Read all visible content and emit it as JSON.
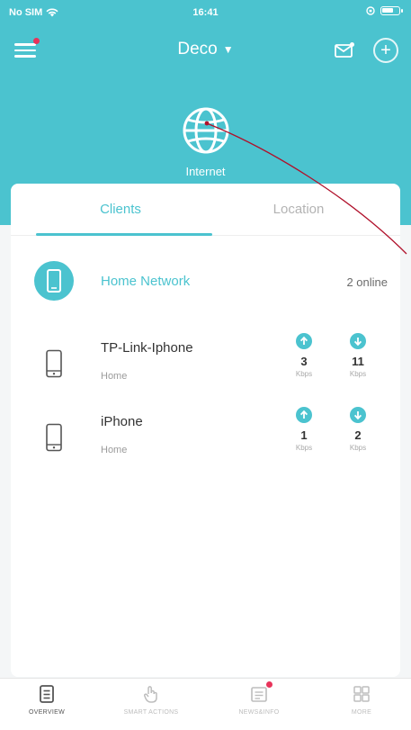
{
  "status_bar": {
    "carrier": "No SIM",
    "time": "16:41"
  },
  "header": {
    "title": "Deco",
    "internet_label": "Internet"
  },
  "tabs": [
    {
      "label": "Clients",
      "active": true
    },
    {
      "label": "Location",
      "active": false
    }
  ],
  "network": {
    "name": "Home Network",
    "online": "2 online",
    "icon": "tablet-icon"
  },
  "clients": [
    {
      "name": "TP-Link-Iphone",
      "location": "Home",
      "upload": "3",
      "download": "11",
      "unit": "Kbps",
      "icon": "phone-icon"
    },
    {
      "name": "iPhone",
      "location": "Home",
      "upload": "1",
      "download": "2",
      "unit": "Kbps",
      "icon": "phone-icon"
    }
  ],
  "bottom_nav": [
    {
      "label": "OVERVIEW",
      "icon": "overview-icon",
      "active": true
    },
    {
      "label": "SMART ACTIONS",
      "icon": "hand-icon",
      "active": false
    },
    {
      "label": "NEWS&INFO",
      "icon": "news-icon",
      "active": false
    },
    {
      "label": "MORE",
      "icon": "grid-icon",
      "active": false
    }
  ],
  "colors": {
    "accent": "#4bc3cf",
    "badge": "#e8335a",
    "annotation": "#b0102a"
  }
}
